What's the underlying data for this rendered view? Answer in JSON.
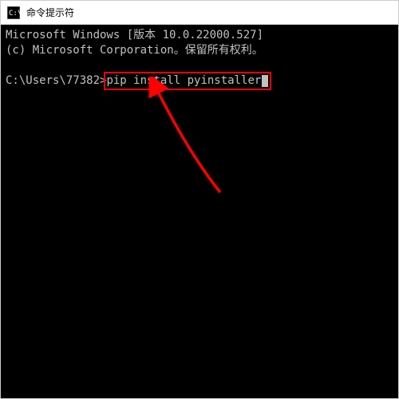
{
  "window": {
    "title": "命令提示符"
  },
  "terminal": {
    "line1": "Microsoft Windows [版本 10.0.22000.527]",
    "line2": "(c) Microsoft Corporation。保留所有权利。",
    "prompt": "C:\\Users\\77382>",
    "command": "pip install pyinstaller"
  },
  "annotations": {
    "highlight_color": "#ff0000",
    "arrow_color": "#ff0000"
  }
}
